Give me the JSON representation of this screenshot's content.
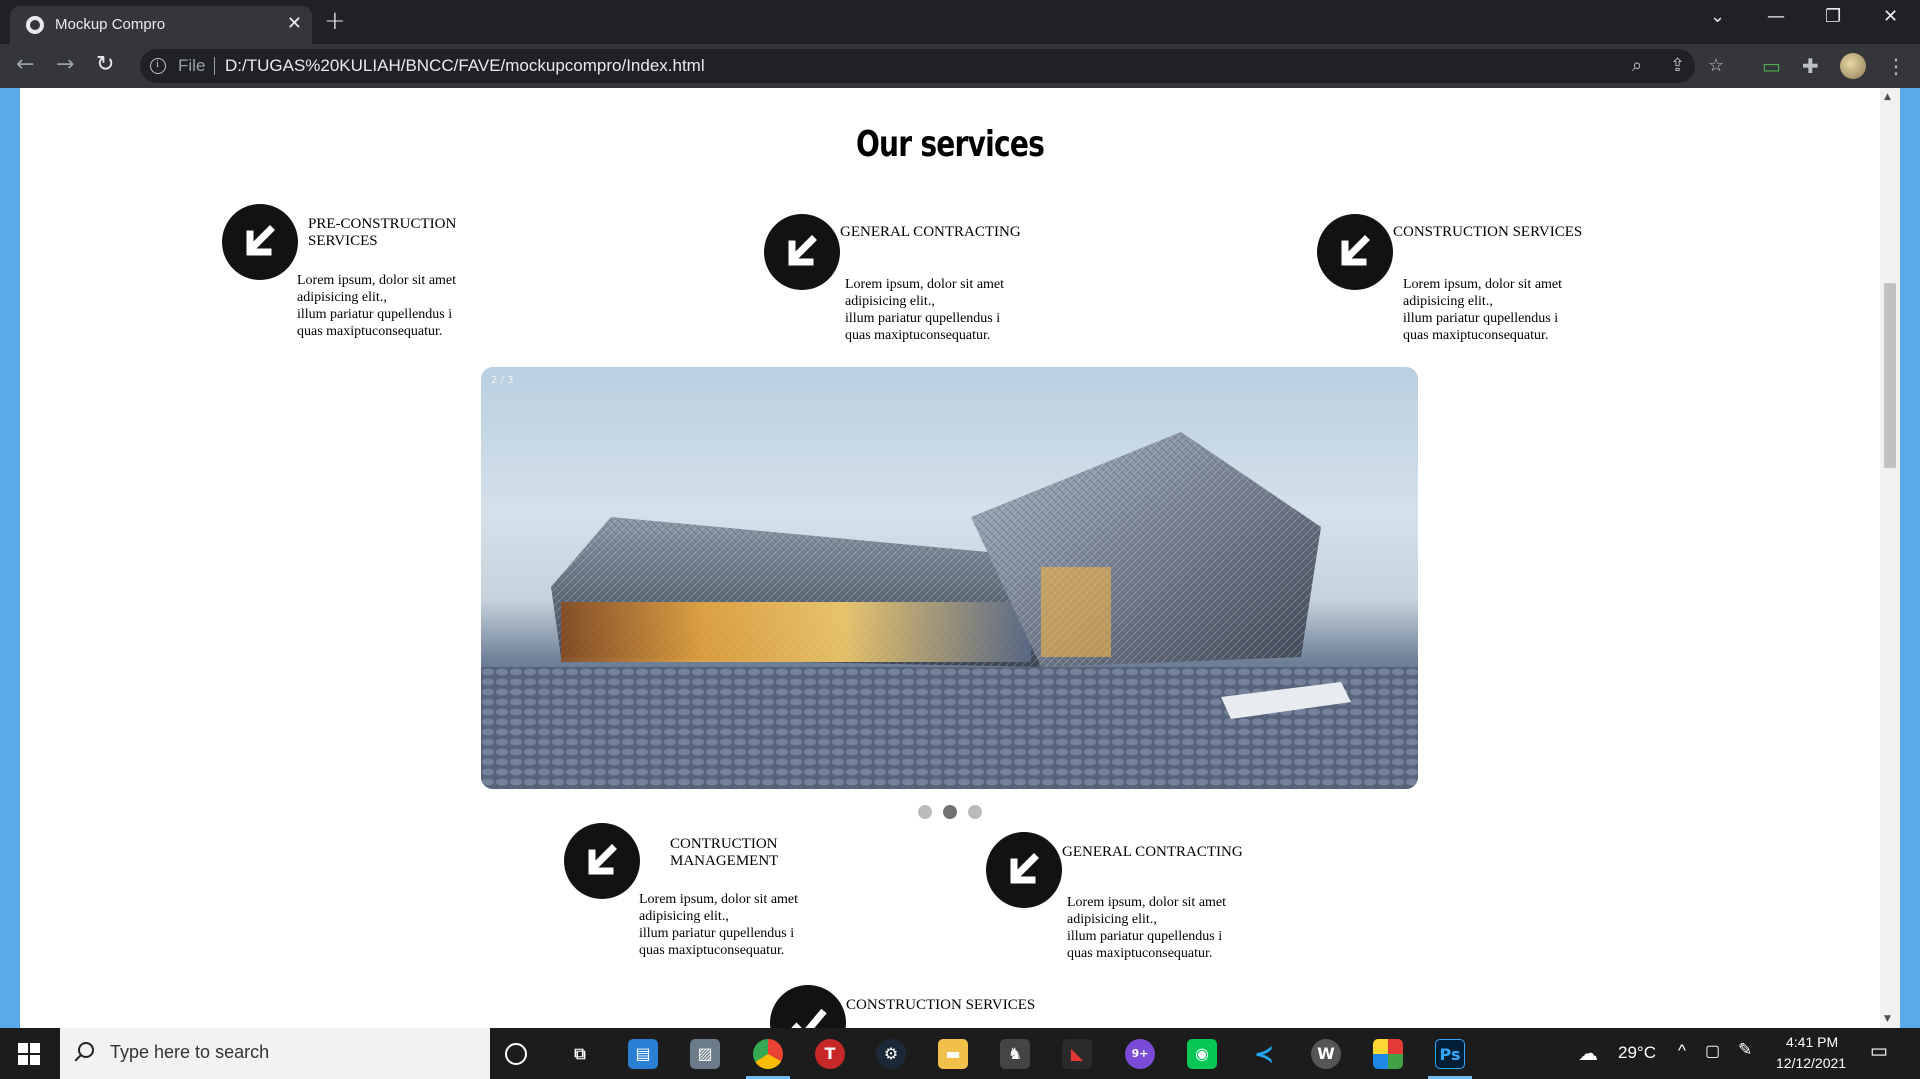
{
  "browser": {
    "tab_title": "Mockup Compro",
    "tab_close": "✕",
    "new_tab": "+",
    "scheme_label": "File",
    "url": "D:/TUGAS%20KULIAH/BNCC/FAVE/mockupcompro/Index.html"
  },
  "page": {
    "title": "Our services",
    "services_top": [
      {
        "title": "PRE-CONSTRUCTION\nSERVICES",
        "desc": "Lorem ipsum, dolor sit amet\nadipisicing elit.,\nillum pariatur qupellendus i\nquas maxiptuconsequatur."
      },
      {
        "title": "GENERAL CONTRACTING",
        "desc": "Lorem ipsum, dolor sit amet\nadipisicing elit.,\nillum pariatur qupellendus i\nquas maxiptuconsequatur."
      },
      {
        "title": "CONSTRUCTION SERVICES",
        "desc": "Lorem ipsum, dolor sit amet\nadipisicing elit.,\nillum pariatur qupellendus i\nquas maxiptuconsequatur."
      }
    ],
    "services_bottom": [
      {
        "title": "CONTRUCTION\nMANAGEMENT",
        "desc": "Lorem ipsum, dolor sit amet\nadipisicing elit.,\nillum pariatur qupellendus i\nquas maxiptuconsequatur."
      },
      {
        "title": "GENERAL CONTRACTING",
        "desc": "Lorem ipsum, dolor sit amet\nadipisicing elit.,\nillum pariatur qupellendus i\nquas maxiptuconsequatur."
      },
      {
        "title": "CONSTRUCTION SERVICES"
      }
    ],
    "slideshow": {
      "counter": "2 / 3",
      "current": 2,
      "total": 3
    }
  },
  "taskbar": {
    "search_placeholder": "Type here to search",
    "temperature": "29°C",
    "time": "4:41 PM",
    "date": "12/12/2021",
    "badge": "9+"
  },
  "colors": {
    "chrome_dark": "#202124",
    "chrome_toolbar": "#35363a",
    "service_circle": "#121212",
    "desktop_blue": "#5aa9e8"
  }
}
